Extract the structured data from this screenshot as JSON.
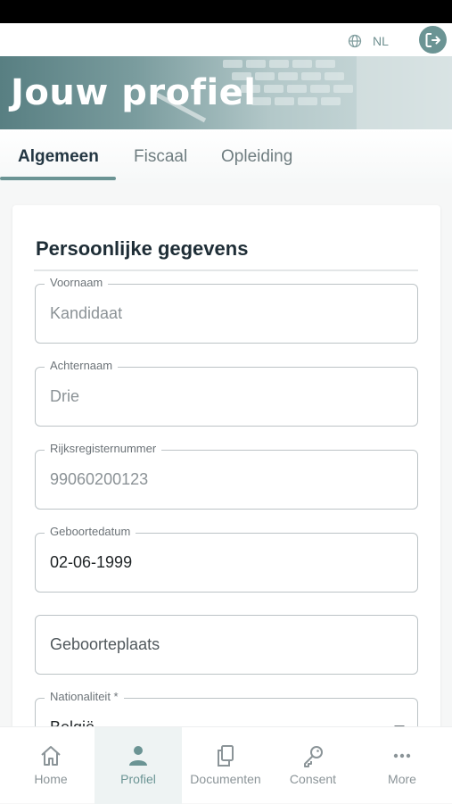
{
  "header": {
    "language": "NL",
    "globe_icon": "globe-icon",
    "logout_icon": "logout-icon"
  },
  "hero": {
    "title": "Jouw profiel"
  },
  "tabs": [
    {
      "label": "Algemeen",
      "active": true
    },
    {
      "label": "Fiscaal",
      "active": false
    },
    {
      "label": "Opleiding",
      "active": false
    }
  ],
  "section": {
    "title": "Persoonlijke gegevens"
  },
  "fields": {
    "voornaam": {
      "label": "Voornaam",
      "value": "Kandidaat"
    },
    "achternaam": {
      "label": "Achternaam",
      "value": "Drie"
    },
    "rijksregisternummer": {
      "label": "Rijksregisternummer",
      "value": "99060200123"
    },
    "geboortedatum": {
      "label": "Geboortedatum",
      "value": "02-06-1999"
    },
    "geboorteplaats": {
      "placeholder": "Geboorteplaats"
    },
    "nationaliteit": {
      "label": "Nationaliteit *",
      "value": "België"
    }
  },
  "bottom_nav": [
    {
      "label": "Home",
      "icon": "home-icon",
      "active": false
    },
    {
      "label": "Profiel",
      "icon": "person-icon",
      "active": true
    },
    {
      "label": "Documenten",
      "icon": "documents-icon",
      "active": false
    },
    {
      "label": "Consent",
      "icon": "key-icon",
      "active": false
    },
    {
      "label": "More",
      "icon": "more-dots-icon",
      "active": false
    }
  ],
  "colors": {
    "accent": "#6b9494",
    "text_dark": "#1e2d36"
  }
}
